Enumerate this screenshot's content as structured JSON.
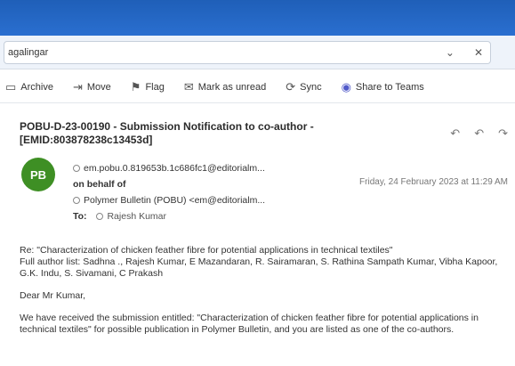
{
  "search": {
    "value": "agalingar"
  },
  "search_actions": [
    "⌄",
    "✕"
  ],
  "toolbar": {
    "items": [
      {
        "icon": "archive-icon",
        "glyph": "▭",
        "label": "Archive"
      },
      {
        "icon": "move-icon",
        "glyph": "⇥",
        "label": "Move"
      },
      {
        "icon": "flag-icon",
        "glyph": "⚑",
        "label": "Flag"
      },
      {
        "icon": "mark-unread-icon",
        "glyph": "✉",
        "label": "Mark as unread"
      },
      {
        "icon": "sync-icon",
        "glyph": "⟳",
        "label": "Sync"
      },
      {
        "icon": "teams-icon",
        "glyph": "◉",
        "label": "Share to Teams"
      }
    ]
  },
  "email": {
    "subject": "POBU-D-23-00190 - Submission Notification to co-author - [EMID:803878238c13453d]",
    "reply_icons": [
      "↶",
      "↶",
      "↷"
    ],
    "avatar_initials": "PB",
    "from_address": "em.pobu.0.819653b.1c686fc1@editorialm...",
    "on_behalf": "on behalf of",
    "sender": "Polymer Bulletin (POBU) <em@editorialm...",
    "to_label": "To:",
    "to_recipient": "Rajesh Kumar",
    "date": "Friday, 24 February 2023 at 11:29 AM",
    "body": {
      "re_line": "Re: \"Characterization of chicken feather fibre for potential applications in technical textiles\"",
      "authors": "Full author list: Sadhna ., Rajesh Kumar, E Mazandaran, R. Sairamaran, S. Rathina Sampath Kumar, Vibha Kapoor, G.K. Indu, S. Sivamani, C Prakash",
      "greeting": "Dear Mr Kumar,",
      "paragraph": "We have received the submission entitled: \"Characterization of chicken feather fibre for potential applications in technical textiles\" for possible publication in Polymer Bulletin, and you are listed as one of the co-authors."
    }
  }
}
